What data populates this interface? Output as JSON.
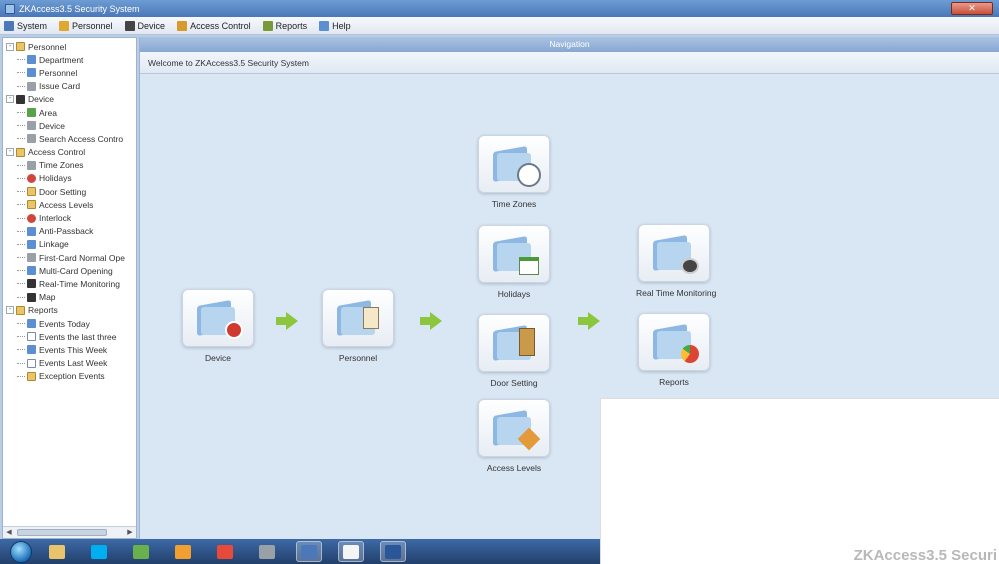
{
  "window": {
    "title": "ZKAccess3.5 Security System",
    "close_label": "✕"
  },
  "menu": [
    {
      "label": "System",
      "color": "#4a78b8"
    },
    {
      "label": "Personnel",
      "color": "#e0a830"
    },
    {
      "label": "Device",
      "color": "#444444"
    },
    {
      "label": "Access Control",
      "color": "#d89a2a"
    },
    {
      "label": "Reports",
      "color": "#7a9a3a"
    },
    {
      "label": "Help",
      "color": "#5b8fd1"
    }
  ],
  "tree": [
    {
      "level": 0,
      "label": "Personnel",
      "expander": "-",
      "icon": "folder"
    },
    {
      "level": 1,
      "label": "Department",
      "icon": "blue"
    },
    {
      "level": 1,
      "label": "Personnel",
      "icon": "blue"
    },
    {
      "level": 1,
      "label": "Issue Card",
      "icon": "gray"
    },
    {
      "level": 0,
      "label": "Device",
      "expander": "-",
      "icon": "dark"
    },
    {
      "level": 1,
      "label": "Area",
      "icon": "green"
    },
    {
      "level": 1,
      "label": "Device",
      "icon": "gray"
    },
    {
      "level": 1,
      "label": "Search Access Contro",
      "icon": "gray"
    },
    {
      "level": 0,
      "label": "Access Control",
      "expander": "-",
      "icon": "folder"
    },
    {
      "level": 1,
      "label": "Time Zones",
      "icon": "gray"
    },
    {
      "level": 1,
      "label": "Holidays",
      "icon": "red"
    },
    {
      "level": 1,
      "label": "Door Setting",
      "icon": "folder"
    },
    {
      "level": 1,
      "label": "Access Levels",
      "icon": "folder"
    },
    {
      "level": 1,
      "label": "Interlock",
      "icon": "red"
    },
    {
      "level": 1,
      "label": "Anti-Passback",
      "icon": "blue"
    },
    {
      "level": 1,
      "label": "Linkage",
      "icon": "blue"
    },
    {
      "level": 1,
      "label": "First-Card Normal Ope",
      "icon": "gray"
    },
    {
      "level": 1,
      "label": "Multi-Card Opening",
      "icon": "blue"
    },
    {
      "level": 1,
      "label": "Real-Time Monitoring",
      "icon": "dark"
    },
    {
      "level": 1,
      "label": "Map",
      "icon": "dark"
    },
    {
      "level": 0,
      "label": "Reports",
      "expander": "-",
      "icon": "folder"
    },
    {
      "level": 1,
      "label": "Events Today",
      "icon": "blue"
    },
    {
      "level": 1,
      "label": "Events the last three",
      "icon": "doc"
    },
    {
      "level": 1,
      "label": "Events This Week",
      "icon": "blue"
    },
    {
      "level": 1,
      "label": "Events Last Week",
      "icon": "doc"
    },
    {
      "level": 1,
      "label": "Exception Events",
      "icon": "folder"
    }
  ],
  "main": {
    "header": "Navigation",
    "welcome": "Welcome to ZKAccess3.5 Security System"
  },
  "nodes": {
    "device": "Device",
    "personnel": "Personnel",
    "time_zones": "Time Zones",
    "holidays": "Holidays",
    "door_setting": "Door Setting",
    "access_levels": "Access Levels",
    "real_time": "Real Time Monitoring",
    "reports": "Reports"
  },
  "taskbar": [
    {
      "name": "explorer",
      "color": "#e9c46a",
      "active": false
    },
    {
      "name": "skype",
      "color": "#00aff0",
      "active": false
    },
    {
      "name": "spider-solitaire",
      "color": "#6ab04c",
      "active": false
    },
    {
      "name": "outlook",
      "color": "#f0a030",
      "active": false
    },
    {
      "name": "chrome",
      "color": "#e84a3a",
      "active": false
    },
    {
      "name": "app",
      "color": "#9aa0a8",
      "active": false
    },
    {
      "name": "zkaccess",
      "color": "#4a78b8",
      "active": true
    },
    {
      "name": "paint",
      "color": "#f5f5f5",
      "active": true
    },
    {
      "name": "word",
      "color": "#2b579a",
      "active": true
    }
  ],
  "watermark": "ZKAccess3.5 Securi"
}
